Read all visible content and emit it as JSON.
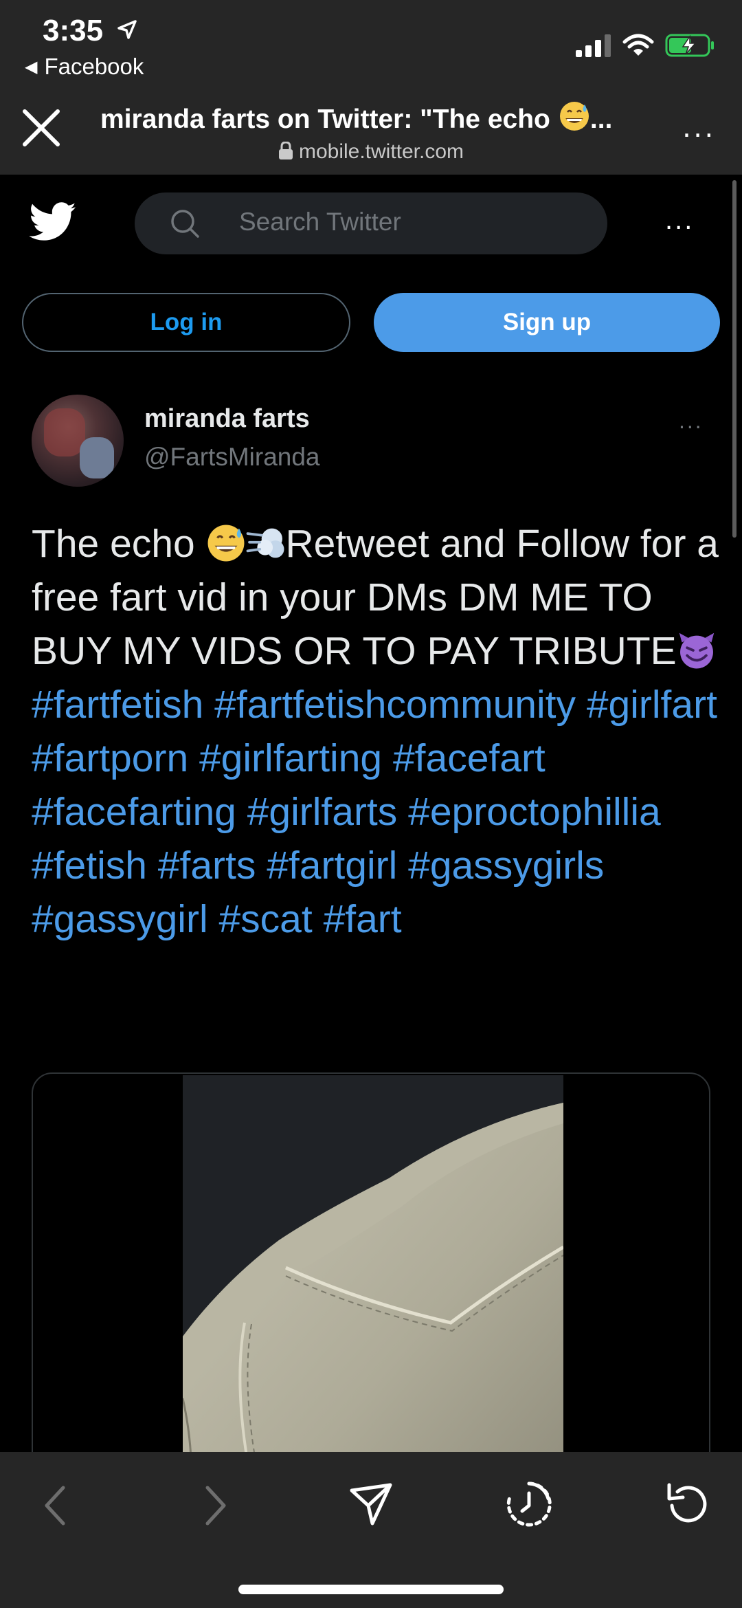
{
  "status_bar": {
    "time": "3:35",
    "back_app": "Facebook"
  },
  "browser": {
    "title": "miranda farts on Twitter: \"The echo",
    "title_ellipsis": "...",
    "url": "mobile.twitter.com",
    "more": "..."
  },
  "twitter_header": {
    "search_placeholder": "Search Twitter",
    "more": "..."
  },
  "auth": {
    "login_label": "Log in",
    "signup_label": "Sign up"
  },
  "tweet": {
    "display_name": "miranda farts",
    "handle": "@FartsMiranda",
    "more": "...",
    "text_start": "The echo ",
    "text_middle": "Retweet and Follow for a free fart vid in your DMs  DM ME TO BUY MY VIDS OR TO PAY TRIBUTE",
    "hashtags": [
      "#fartfetish",
      "#fartfetishcommunity",
      "#girlfart",
      "#fartporn",
      "#girlfarting",
      "#facefart",
      "#facefarting",
      "#girlfarts",
      "#eproctophillia",
      "#fetish",
      "#farts",
      "#fartgirl",
      "#gassygirls",
      "#gassygirl",
      "#scat",
      "#fart"
    ]
  },
  "icons": {
    "twitter": "twitter-bird-icon",
    "search": "search-icon",
    "close": "close-icon",
    "lock": "lock-icon",
    "share": "share-icon",
    "history": "history-icon",
    "refresh": "refresh-icon"
  },
  "colors": {
    "link": "#4c9be8",
    "signup_bg": "#4c9be8",
    "chrome": "#262626",
    "battery": "#34c759"
  }
}
